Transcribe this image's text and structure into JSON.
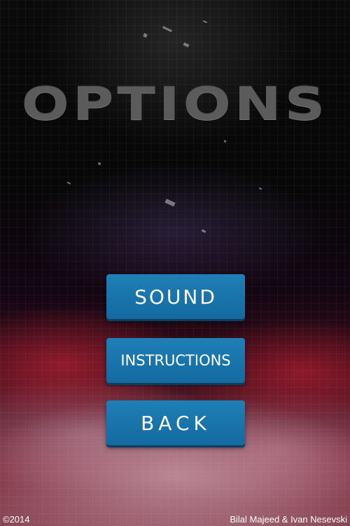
{
  "screen": {
    "title": "OPTIONS"
  },
  "menu": {
    "buttons": [
      {
        "label": "SOUND"
      },
      {
        "label": "INSTRUCTIONS"
      },
      {
        "label": "BACK"
      }
    ]
  },
  "footer": {
    "copyright": "©2014",
    "credits": "Bilal Majeed & Ivan Nesevski"
  },
  "colors": {
    "button_fill": "#1a76ad",
    "title_color": "#5b5b5b",
    "accent_smoke": "#c8283c"
  }
}
